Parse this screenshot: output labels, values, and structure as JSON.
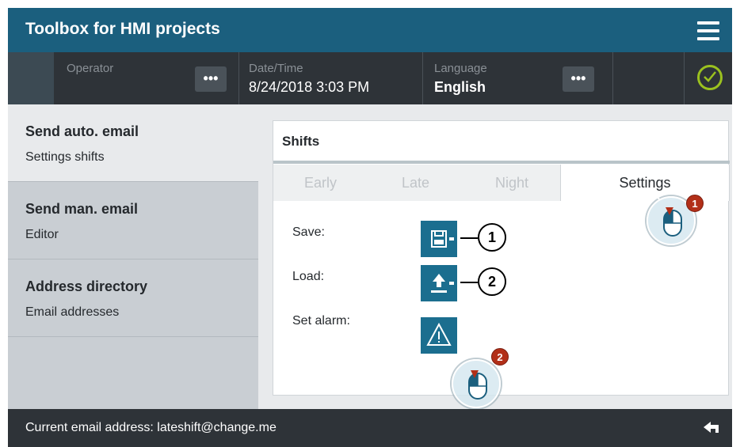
{
  "app": {
    "title": "Toolbox for HMI projects"
  },
  "statusbar": {
    "operator_label": "Operator",
    "datetime_label": "Date/Time",
    "datetime_value": "8/24/2018 3:03 PM",
    "language_label": "Language",
    "language_value": "English",
    "more_label": "•••"
  },
  "sidebar": {
    "items": [
      {
        "title": "Send auto. email",
        "subtitle": "Settings shifts"
      },
      {
        "title": "Send man. email",
        "subtitle": "Editor"
      },
      {
        "title": "Address directory",
        "subtitle": "Email addresses"
      }
    ]
  },
  "panel": {
    "title": "Shifts",
    "tabs": [
      "Early",
      "Late",
      "Night",
      "Settings"
    ],
    "rows": [
      {
        "label": "Save:",
        "icon": "save-icon",
        "callout": "1"
      },
      {
        "label": "Load:",
        "icon": "upload-icon",
        "callout": "2"
      },
      {
        "label": "Set alarm:",
        "icon": "warning-icon"
      }
    ]
  },
  "footer": {
    "text": "Current email address: lateshift@change.me"
  },
  "overlays": {
    "badge_1": "1",
    "badge_2": "2"
  },
  "colors": {
    "titlebar": "#1b5f7e",
    "statusbar": "#2e3338",
    "accent_button": "#1b6e8f",
    "check_green": "#9bc11f",
    "badge_red": "#b22f18"
  }
}
